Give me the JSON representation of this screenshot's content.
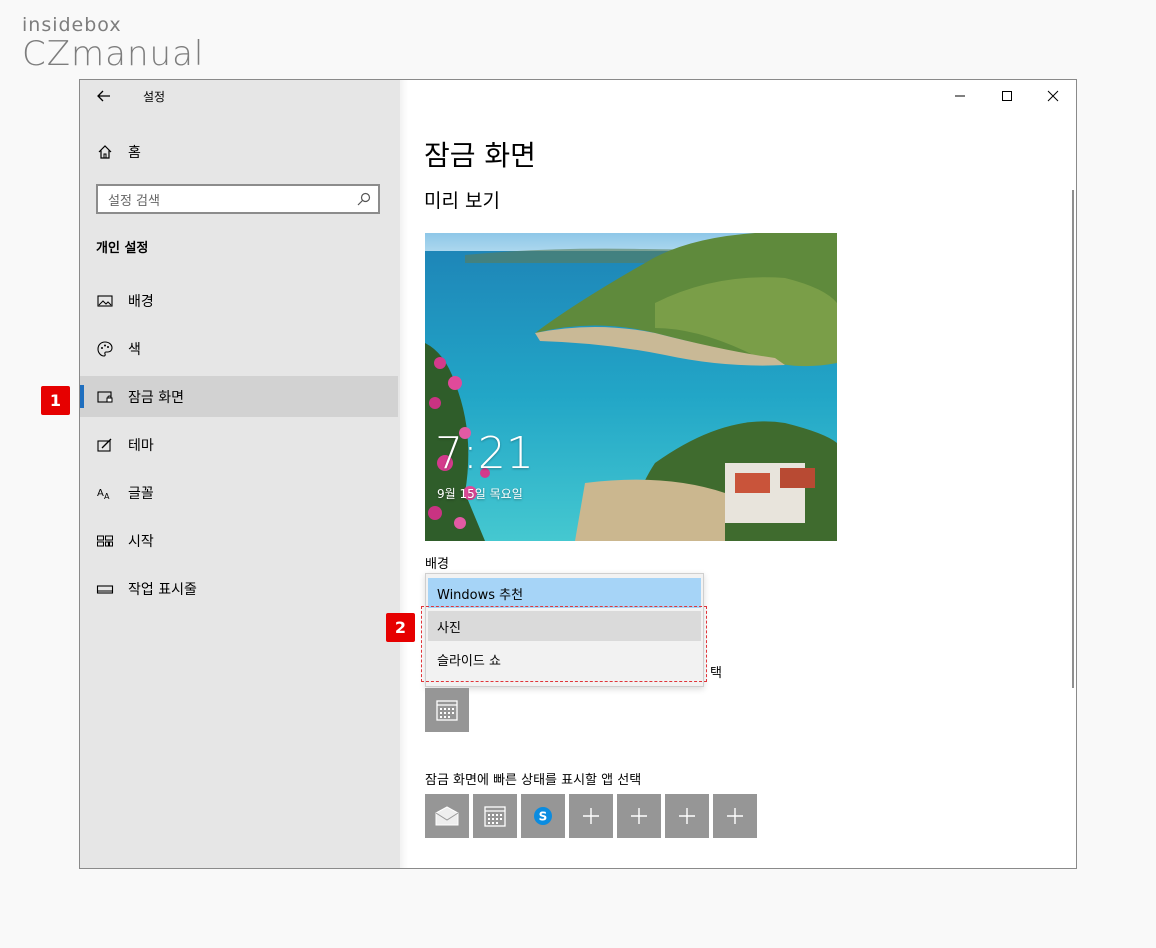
{
  "logo": {
    "line1": "insidebox",
    "line2": "CZmanual"
  },
  "window": {
    "title": "설정",
    "home_label": "홈",
    "search_placeholder": "설정 검색",
    "section_title": "개인 설정",
    "nav": [
      {
        "label": "배경",
        "icon": "image-icon"
      },
      {
        "label": "색",
        "icon": "palette-icon"
      },
      {
        "label": "잠금 화면",
        "icon": "lock-screen-icon",
        "active": true
      },
      {
        "label": "테마",
        "icon": "theme-icon"
      },
      {
        "label": "글꼴",
        "icon": "font-icon"
      },
      {
        "label": "시작",
        "icon": "start-icon"
      },
      {
        "label": "작업 표시줄",
        "icon": "taskbar-icon"
      }
    ]
  },
  "content": {
    "page_title": "잠금 화면",
    "preview_title": "미리 보기",
    "preview_time": "7:21",
    "preview_date": "9월 15일 목요일",
    "background_label": "배경",
    "dropdown_options": [
      "Windows 추천",
      "사진",
      "슬라이드 쇼"
    ],
    "dropdown_selected": "Windows 추천",
    "partial_text": "택",
    "quick_status_label": "잠금 화면에 빠른 상태를 표시할 앱 선택"
  },
  "annotations": {
    "badge1": "1",
    "badge2": "2"
  },
  "colors": {
    "accent": "#1f6fbf",
    "selected": "#a6d4f7",
    "badge": "#e60000",
    "tile": "#969696"
  }
}
